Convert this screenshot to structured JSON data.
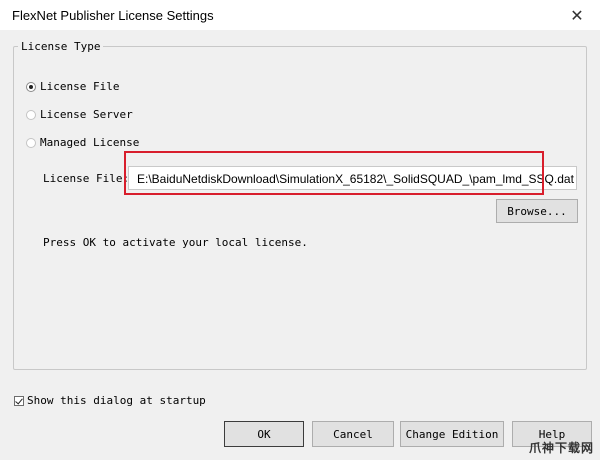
{
  "window": {
    "title": "FlexNet Publisher License Settings",
    "close_glyph": "✕"
  },
  "license_type": {
    "legend": "License Type",
    "options": [
      {
        "label": "License File",
        "checked": true,
        "enabled": true
      },
      {
        "label": "License Server",
        "checked": false,
        "enabled": false
      },
      {
        "label": "Managed License",
        "checked": false,
        "enabled": false
      }
    ],
    "license_file_label": "License File:",
    "license_file_value": "E:\\BaiduNetdiskDownload\\SimulationX_65182\\_SolidSQUAD_\\pam_lmd_SSQ.dat",
    "browse_label": "Browse...",
    "hint": "Press OK to activate your local license."
  },
  "startup": {
    "label": "Show this dialog at startup",
    "checked": true
  },
  "buttons": {
    "ok": "OK",
    "cancel": "Cancel",
    "change_edition": "Change Edition",
    "help": "Help"
  },
  "watermark": "爪神下载网",
  "colors": {
    "highlight": "#d81e2c",
    "client_bg": "#f0f0f0"
  }
}
